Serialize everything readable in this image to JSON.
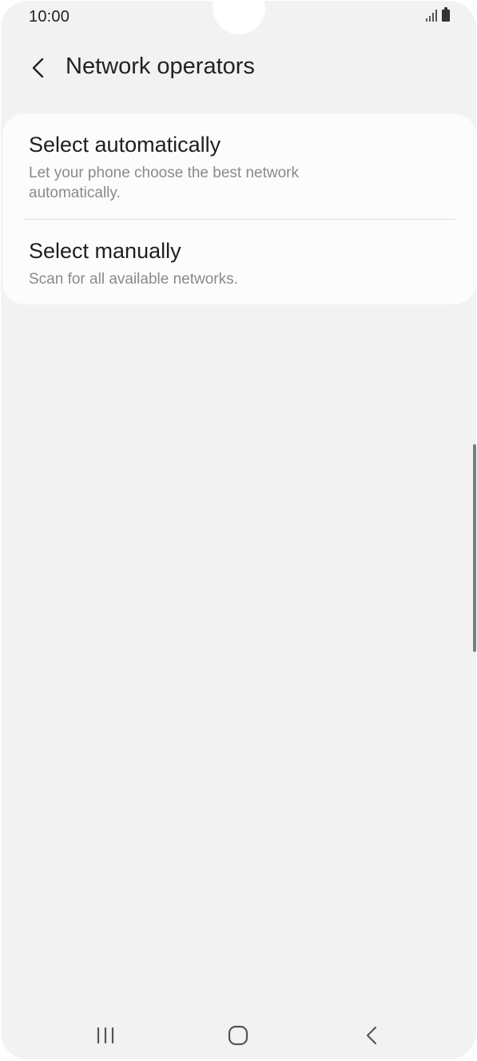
{
  "status_bar": {
    "time": "10:00",
    "icons": [
      "signal-icon",
      "battery-icon"
    ]
  },
  "header": {
    "back_icon": "chevron-left-icon",
    "title": "Network operators"
  },
  "options": [
    {
      "title": "Select automatically",
      "description": "Let your phone choose the best network automatically."
    },
    {
      "title": "Select manually",
      "description": "Scan for all available networks."
    }
  ],
  "nav_bar": {
    "icons": [
      "recent-apps-icon",
      "home-icon",
      "back-icon"
    ]
  },
  "colors": {
    "background": "#f2f2f2",
    "card": "#fcfcfc",
    "title_text": "#1f1f1f",
    "secondary_text": "#8a8a8a"
  }
}
